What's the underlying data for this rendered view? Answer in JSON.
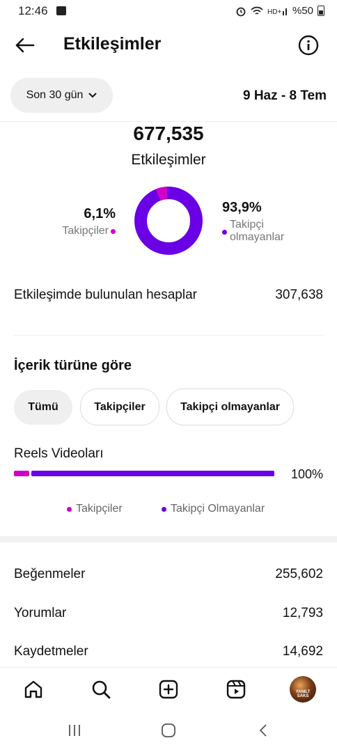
{
  "status": {
    "time": "12:46",
    "right_text": "%50"
  },
  "header": {
    "title": "Etkileşimler",
    "back_icon": "arrow-left-icon",
    "info_icon": "info-icon"
  },
  "period": {
    "selected": "Son 30 gün",
    "range": "9 Haz - 8 Tem"
  },
  "summary": {
    "total": "677,535",
    "label": "Etkileşimler",
    "followers": {
      "percent": "6,1%",
      "label": "Takipçiler",
      "fraction": 0.061
    },
    "non_followers": {
      "percent": "93,9%",
      "label_line1": "Takipçi",
      "label_line2": "olmayanlar",
      "fraction": 0.939
    }
  },
  "accounts_engaged": {
    "label": "Etkileşimde bulunulan hesaplar",
    "value": "307,638"
  },
  "content_type": {
    "title": "İçerik türüne göre",
    "tabs": [
      "Tümü",
      "Takipçiler",
      "Takipçi olmayanlar"
    ],
    "active_tab": 0,
    "reels": {
      "label": "Reels Videoları",
      "percent": "100%",
      "followers_fraction": 0.061
    },
    "legend": {
      "followers": "Takipçiler",
      "non_followers": "Takipçi Olmayanlar"
    }
  },
  "metrics": [
    {
      "label": "Beğenmeler",
      "value": "255,602"
    },
    {
      "label": "Yorumlar",
      "value": "12,793"
    },
    {
      "label": "Kaydetmeler",
      "value": "14,692"
    }
  ],
  "avatar_text": "YANILT SAKS",
  "colors": {
    "followers": "#d100c8",
    "non_followers": "#6a00e6"
  }
}
